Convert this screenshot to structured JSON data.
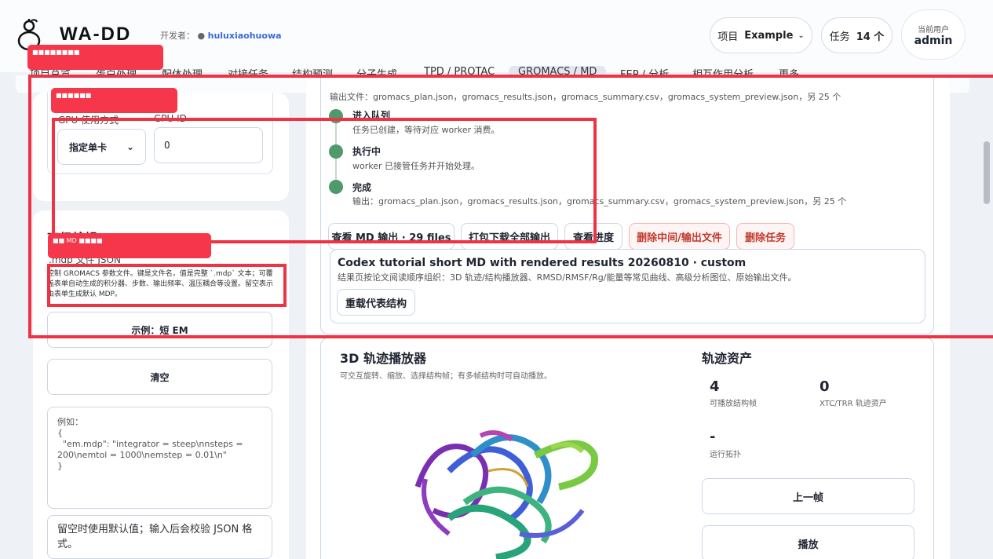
{
  "header": {
    "brand": "WA-DD",
    "developer_label": "开发者：",
    "developer_handle": "huluxiaohuowa",
    "project_label": "项目",
    "project_value": "Example",
    "tasks_label": "任务",
    "tasks_value": "14 个",
    "user_label": "当前用户",
    "user_name": "admin"
  },
  "nav": {
    "items": [
      "项目总览",
      "蛋白处理",
      "配体处理",
      "对接任务",
      "结构预测",
      "分子生成",
      "TPD / PROTAC",
      "GROMACS / MD",
      "FEP / 分析",
      "相互作用分析",
      "更多"
    ],
    "active": "GROMACS / MD"
  },
  "left": {
    "gpu_mode_label": "GPU 使用方式",
    "gpu_mode_value": "指定单卡",
    "gpu_id_label": "GPU ID",
    "gpu_id_value": "0",
    "advanced_title": "高级编辑",
    "mdp_label": ".mdp 文件 JSON",
    "mdp_note": "控制 GROMACS 参数文件。键是文件名，值是完整 `.mdp` 文本；可覆盖表单自动生成的积分器、步数、输出频率、温压耦合等设置。留空表示由表单生成默认 MDP。",
    "example_button": "示例：短 EM",
    "clear_button": "清空",
    "textarea_placeholder": "例如：\n{\n  \"em.mdp\": \"integrator = steep\\nnsteps =\n200\\nemtol = 1000\\nemstep = 0.01\\n\"\n}",
    "hint": "留空时使用默认值；输入后会校验 JSON 格式。"
  },
  "task": {
    "output_files": "输出文件：gromacs_plan.json，gromacs_results.json，gromacs_summary.csv，gromacs_system_preview.json，另 25 个",
    "steps": [
      {
        "title": "进入队列",
        "desc": "任务已创建，等待对应 worker 消费。"
      },
      {
        "title": "执行中",
        "desc": "worker 已接管任务并开始处理。"
      },
      {
        "title": "完成",
        "desc": "输出：gromacs_plan.json，gromacs_results.json，gromacs_summary.csv，gromacs_system_preview.json，另 25 个"
      }
    ],
    "buttons": {
      "view_output": "查看 MD 输出 · 29 files",
      "download_all": "打包下载全部输出",
      "view_progress": "查看进度",
      "delete_outputs": "删除中间/输出文件",
      "delete_task": "删除任务"
    },
    "run_title": "Codex tutorial short MD with rendered results 20260810 · custom",
    "run_desc": "结果页按论文阅读顺序组织：3D 轨迹/结构播放器、RMSD/RMSF/Rg/能量等常见曲线、高级分析图位、原始输出文件。",
    "reload_button": "重载代表结构"
  },
  "player": {
    "title": "3D 轨迹播放器",
    "subtitle": "可交互旋转、缩放、选择结构帧；有多帧结构时可自动播放。",
    "assets_title": "轨迹资产",
    "frames_value": "4",
    "frames_label": "可播放结构帧",
    "xtc_value": "0",
    "xtc_label": "XTC/TRR 轨迹资产",
    "topology_value": "-",
    "topology_label": "运行拓扑",
    "prev_button": "上一帧",
    "play_button": "播放"
  },
  "annotations": {
    "label1": "■■■■■■■■",
    "label2": "■■■■■■",
    "label3": "■■ MD ■■■■"
  },
  "colors": {
    "success": "#4e9a6a",
    "danger": "#c0392b",
    "annotation": "#ee3344"
  }
}
